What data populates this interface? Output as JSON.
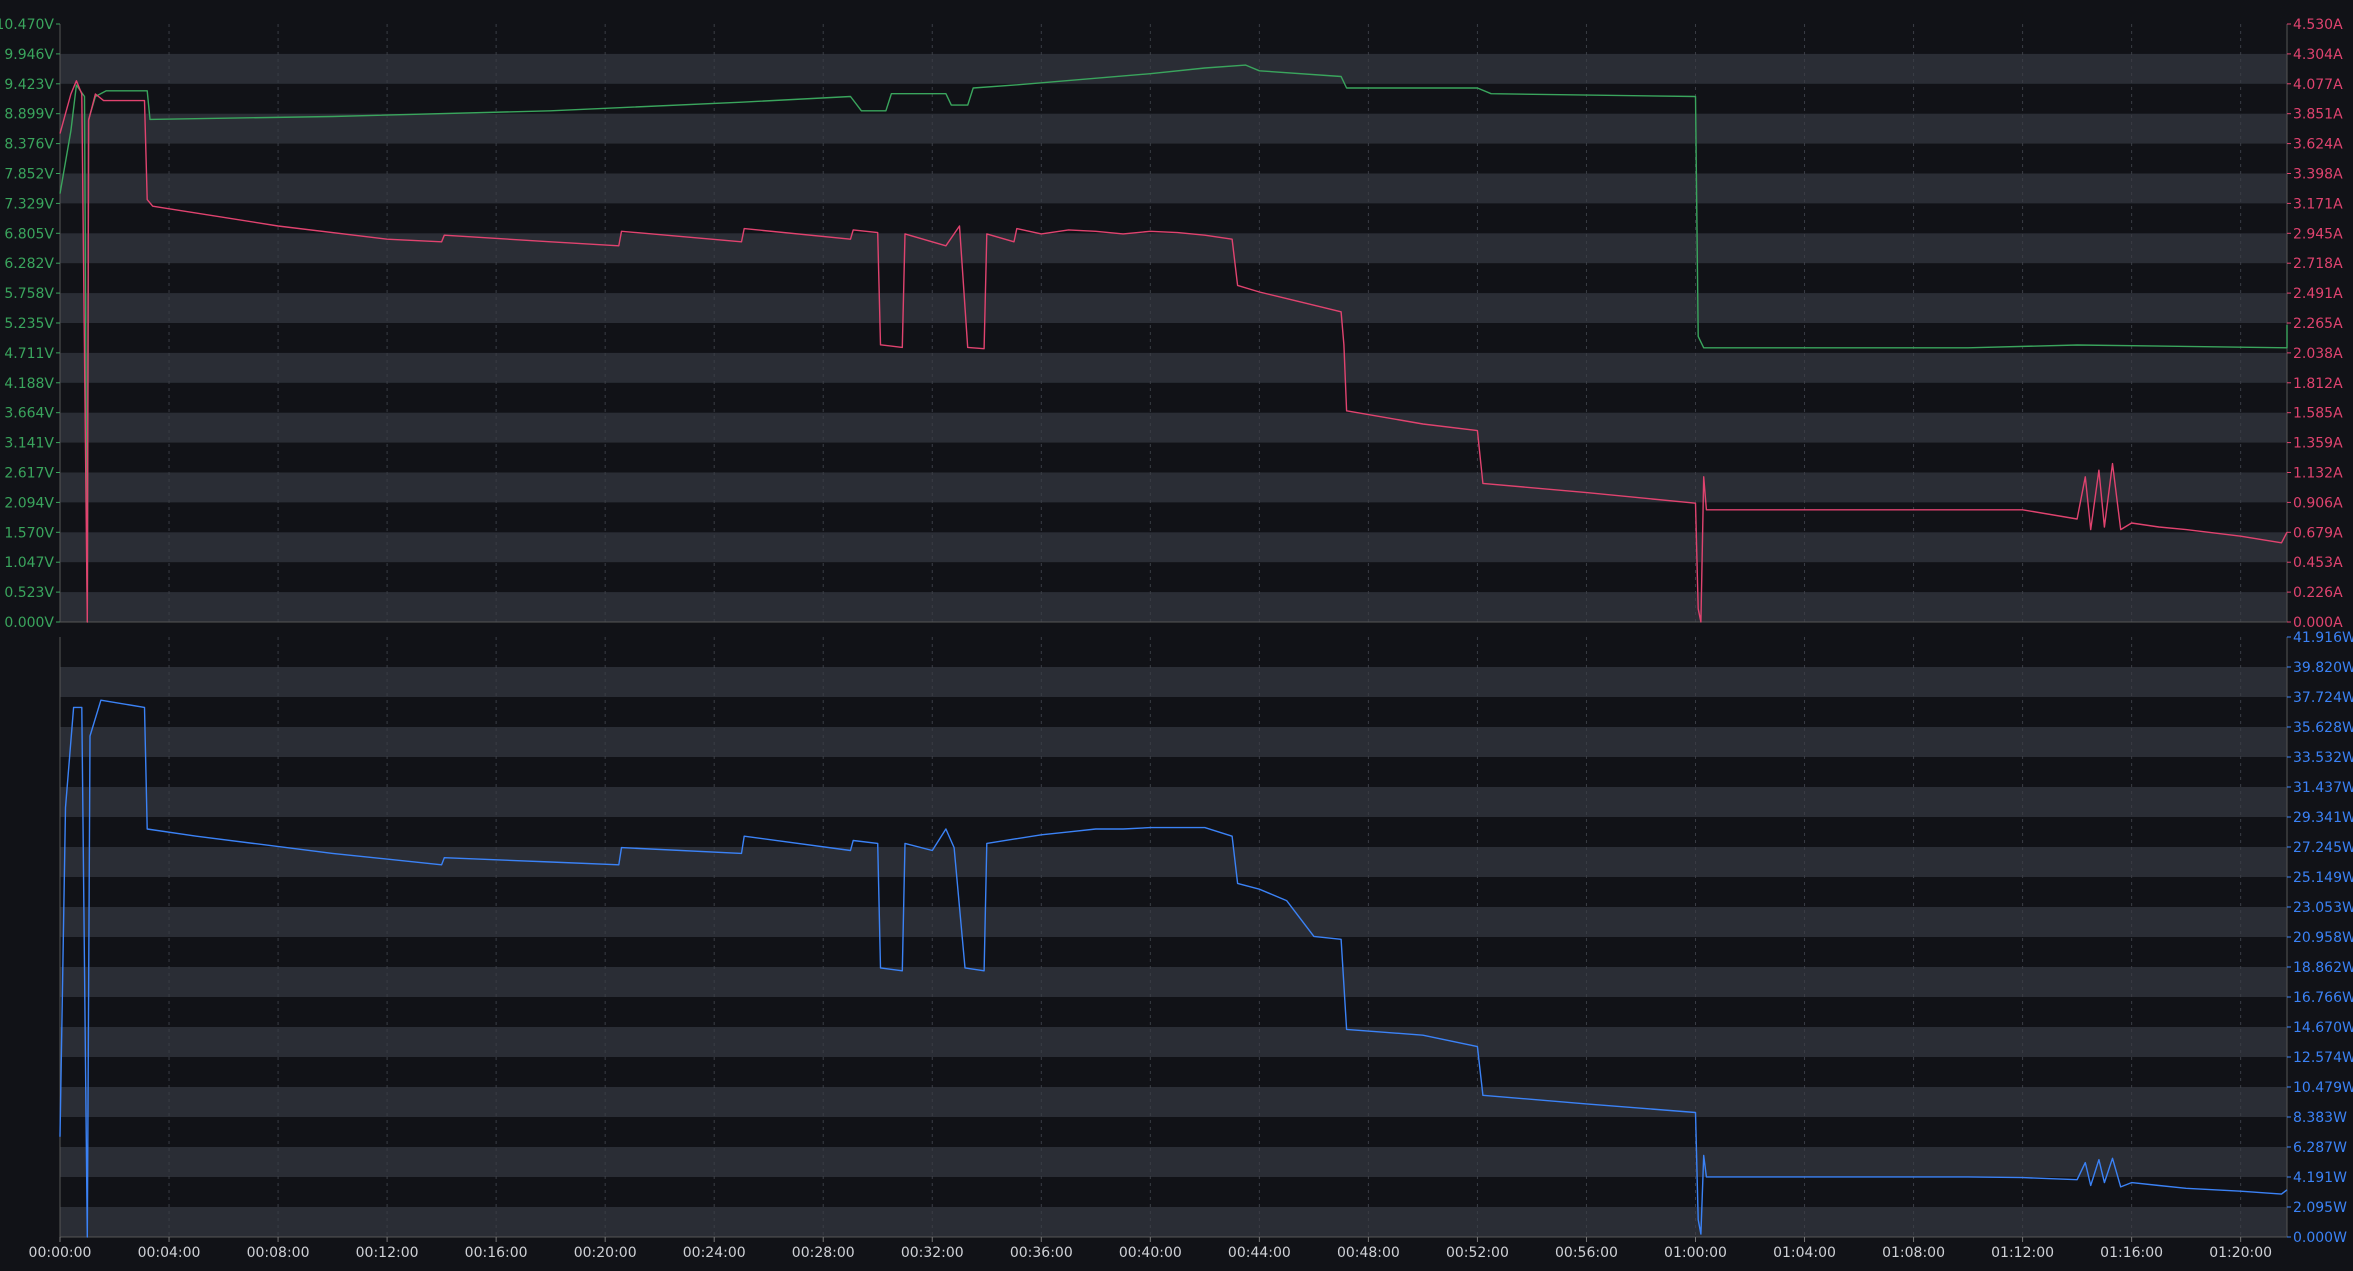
{
  "colors": {
    "background": "#111217",
    "band": "#2a2d35",
    "grid": "#3a3d45",
    "voltage": "#3aa55d",
    "current": "#e0436f",
    "power": "#3b82f6",
    "xtick": "#cfd1d6"
  },
  "chart_data": [
    {
      "type": "line",
      "id": "top",
      "x_unit": "minutes",
      "xlim": [
        0,
        81.7
      ],
      "y_left": {
        "label": "",
        "ylim": [
          0,
          10.47
        ],
        "ticks": [
          "0.000V",
          "0.523V",
          "1.047V",
          "1.570V",
          "2.094V",
          "2.617V",
          "3.141V",
          "3.664V",
          "4.188V",
          "4.711V",
          "5.235V",
          "5.758V",
          "6.282V",
          "6.805V",
          "7.329V",
          "7.852V",
          "8.376V",
          "8.899V",
          "9.423V",
          "9.946V",
          "10.470V"
        ]
      },
      "y_right": {
        "label": "",
        "ylim": [
          0,
          4.53
        ],
        "ticks": [
          "0.000A",
          "0.226A",
          "0.453A",
          "0.679A",
          "0.906A",
          "1.132A",
          "1.359A",
          "1.585A",
          "1.812A",
          "2.038A",
          "2.265A",
          "2.491A",
          "2.718A",
          "2.945A",
          "3.171A",
          "3.398A",
          "3.624A",
          "3.851A",
          "4.077A",
          "4.304A",
          "4.530A"
        ]
      },
      "series": [
        {
          "axis": "left",
          "color": "#3aa55d",
          "points": [
            [
              0,
              7.5
            ],
            [
              0.4,
              8.6
            ],
            [
              0.6,
              9.4
            ],
            [
              0.9,
              9.2
            ],
            [
              1.0,
              0.0
            ],
            [
              1.05,
              8.8
            ],
            [
              1.3,
              9.2
            ],
            [
              1.7,
              9.3
            ],
            [
              3.2,
              9.3
            ],
            [
              3.3,
              8.8
            ],
            [
              10,
              8.85
            ],
            [
              18,
              8.95
            ],
            [
              25,
              9.1
            ],
            [
              29,
              9.2
            ],
            [
              29.4,
              8.95
            ],
            [
              30.3,
              8.95
            ],
            [
              30.5,
              9.25
            ],
            [
              32.5,
              9.25
            ],
            [
              32.7,
              9.05
            ],
            [
              33.3,
              9.05
            ],
            [
              33.5,
              9.35
            ],
            [
              35,
              9.4
            ],
            [
              40,
              9.6
            ],
            [
              42,
              9.7
            ],
            [
              43.5,
              9.75
            ],
            [
              44,
              9.65
            ],
            [
              47,
              9.55
            ],
            [
              47.2,
              9.35
            ],
            [
              52,
              9.35
            ],
            [
              52.5,
              9.25
            ],
            [
              60,
              9.2
            ],
            [
              60.1,
              5.0
            ],
            [
              60.3,
              4.8
            ],
            [
              61,
              4.8
            ],
            [
              70,
              4.8
            ],
            [
              74,
              4.85
            ],
            [
              82,
              4.8
            ],
            [
              81.7,
              5.2
            ]
          ]
        },
        {
          "axis": "right",
          "color": "#e0436f",
          "points": [
            [
              0,
              3.7
            ],
            [
              0.4,
              4.0
            ],
            [
              0.6,
              4.1
            ],
            [
              0.8,
              4.0
            ],
            [
              1.0,
              0.0
            ],
            [
              1.05,
              3.8
            ],
            [
              1.3,
              4.0
            ],
            [
              1.6,
              3.95
            ],
            [
              2.2,
              3.95
            ],
            [
              3.1,
              3.95
            ],
            [
              3.2,
              3.2
            ],
            [
              3.4,
              3.15
            ],
            [
              8,
              3.0
            ],
            [
              12,
              2.9
            ],
            [
              14,
              2.88
            ],
            [
              14.1,
              2.93
            ],
            [
              18,
              2.88
            ],
            [
              20.5,
              2.85
            ],
            [
              20.6,
              2.96
            ],
            [
              25,
              2.88
            ],
            [
              25.1,
              2.98
            ],
            [
              29,
              2.9
            ],
            [
              29.1,
              2.97
            ],
            [
              30,
              2.95
            ],
            [
              30.1,
              2.1
            ],
            [
              30.9,
              2.08
            ],
            [
              31,
              2.94
            ],
            [
              32.5,
              2.85
            ],
            [
              33,
              3.0
            ],
            [
              33.3,
              2.08
            ],
            [
              33.9,
              2.07
            ],
            [
              34,
              2.94
            ],
            [
              35,
              2.88
            ],
            [
              35.1,
              2.98
            ],
            [
              36,
              2.94
            ],
            [
              37,
              2.97
            ],
            [
              38,
              2.96
            ],
            [
              39,
              2.94
            ],
            [
              40,
              2.96
            ],
            [
              41,
              2.95
            ],
            [
              42,
              2.93
            ],
            [
              43,
              2.9
            ],
            [
              43.2,
              2.55
            ],
            [
              44,
              2.5
            ],
            [
              45,
              2.45
            ],
            [
              46,
              2.4
            ],
            [
              47,
              2.35
            ],
            [
              47.1,
              2.1
            ],
            [
              47.2,
              1.6
            ],
            [
              50,
              1.5
            ],
            [
              52,
              1.45
            ],
            [
              52.2,
              1.05
            ],
            [
              56,
              0.98
            ],
            [
              60,
              0.9
            ],
            [
              60.1,
              0.1
            ],
            [
              60.2,
              0.0
            ],
            [
              60.3,
              1.1
            ],
            [
              60.4,
              0.85
            ],
            [
              70,
              0.85
            ],
            [
              72,
              0.85
            ],
            [
              74,
              0.78
            ],
            [
              74.3,
              1.1
            ],
            [
              74.5,
              0.7
            ],
            [
              74.8,
              1.15
            ],
            [
              75,
              0.72
            ],
            [
              75.3,
              1.2
            ],
            [
              75.6,
              0.7
            ],
            [
              76,
              0.75
            ],
            [
              77,
              0.72
            ],
            [
              78,
              0.7
            ],
            [
              80,
              0.65
            ],
            [
              81.5,
              0.6
            ],
            [
              81.7,
              0.68
            ]
          ]
        }
      ]
    },
    {
      "type": "line",
      "id": "bottom",
      "x_unit": "minutes",
      "xlim": [
        0,
        81.7
      ],
      "x_ticks": [
        "00:00:00",
        "00:04:00",
        "00:08:00",
        "00:12:00",
        "00:16:00",
        "00:20:00",
        "00:24:00",
        "00:28:00",
        "00:32:00",
        "00:36:00",
        "00:40:00",
        "00:44:00",
        "00:48:00",
        "00:52:00",
        "00:56:00",
        "01:00:00",
        "01:04:00",
        "01:08:00",
        "01:12:00",
        "01:16:00",
        "01:20:00"
      ],
      "y_right": {
        "label": "",
        "ylim": [
          0,
          41.916
        ],
        "ticks": [
          "0.000W",
          "2.095W",
          "4.191W",
          "6.287W",
          "8.383W",
          "10.479W",
          "12.574W",
          "14.670W",
          "16.766W",
          "18.862W",
          "20.958W",
          "23.053W",
          "25.149W",
          "27.245W",
          "29.341W",
          "31.437W",
          "33.532W",
          "35.628W",
          "37.724W",
          "39.820W",
          "41.916W"
        ]
      },
      "series": [
        {
          "axis": "right",
          "color": "#3b82f6",
          "points": [
            [
              0,
              7
            ],
            [
              0.2,
              30
            ],
            [
              0.5,
              37
            ],
            [
              0.8,
              37
            ],
            [
              1.0,
              0.0
            ],
            [
              1.1,
              35
            ],
            [
              1.5,
              37.5
            ],
            [
              3.1,
              37
            ],
            [
              3.2,
              28.5
            ],
            [
              5,
              28
            ],
            [
              10,
              26.8
            ],
            [
              14,
              26
            ],
            [
              14.1,
              26.5
            ],
            [
              18,
              26.2
            ],
            [
              20.5,
              26.0
            ],
            [
              20.6,
              27.2
            ],
            [
              25,
              26.8
            ],
            [
              25.1,
              28
            ],
            [
              29,
              27
            ],
            [
              29.1,
              27.7
            ],
            [
              30,
              27.5
            ],
            [
              30.1,
              18.8
            ],
            [
              30.9,
              18.6
            ],
            [
              31,
              27.5
            ],
            [
              32,
              27
            ],
            [
              32.5,
              28.5
            ],
            [
              32.8,
              27.2
            ],
            [
              33.2,
              18.8
            ],
            [
              33.9,
              18.6
            ],
            [
              34,
              27.5
            ],
            [
              35,
              27.8
            ],
            [
              36,
              28.1
            ],
            [
              37,
              28.3
            ],
            [
              38,
              28.5
            ],
            [
              39,
              28.5
            ],
            [
              40,
              28.6
            ],
            [
              41,
              28.6
            ],
            [
              42,
              28.6
            ],
            [
              43,
              28
            ],
            [
              43.2,
              24.7
            ],
            [
              44,
              24.3
            ],
            [
              45,
              23.5
            ],
            [
              46,
              21
            ],
            [
              47,
              20.8
            ],
            [
              47.2,
              14.5
            ],
            [
              50,
              14.1
            ],
            [
              52,
              13.3
            ],
            [
              52.2,
              9.9
            ],
            [
              56,
              9.3
            ],
            [
              60,
              8.7
            ],
            [
              60.1,
              1.2
            ],
            [
              60.2,
              0.2
            ],
            [
              60.3,
              5.7
            ],
            [
              60.4,
              4.2
            ],
            [
              70,
              4.2
            ],
            [
              72,
              4.15
            ],
            [
              74,
              4.0
            ],
            [
              74.3,
              5.2
            ],
            [
              74.5,
              3.6
            ],
            [
              74.8,
              5.4
            ],
            [
              75,
              3.8
            ],
            [
              75.3,
              5.5
            ],
            [
              75.6,
              3.5
            ],
            [
              76,
              3.8
            ],
            [
              77,
              3.6
            ],
            [
              78,
              3.4
            ],
            [
              80,
              3.2
            ],
            [
              81.5,
              3.0
            ],
            [
              81.7,
              3.3
            ]
          ]
        }
      ]
    }
  ]
}
